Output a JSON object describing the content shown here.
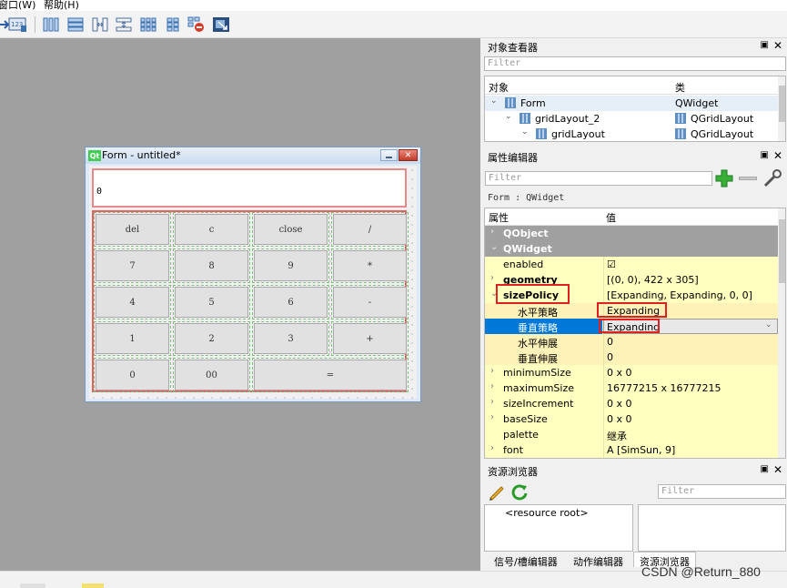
{
  "menubar": {
    "window_menu": "窗口(W)",
    "help_menu": "帮助(H)"
  },
  "toolbar": {
    "icons": [
      "tab-order-icon",
      "layout-horizontal-icon",
      "layout-vertical-icon",
      "splitter-horizontal-icon",
      "splitter-vertical-icon",
      "layout-form-icon",
      "layout-grid-icon",
      "break-layout-icon",
      "adjust-size-icon"
    ]
  },
  "form": {
    "window_title": "Form - untitled*",
    "logo_text": "Qt",
    "display_value": "0",
    "buttons": [
      {
        "label": "del"
      },
      {
        "label": "c"
      },
      {
        "label": "close"
      },
      {
        "label": "/"
      },
      {
        "label": "7"
      },
      {
        "label": "8"
      },
      {
        "label": "9"
      },
      {
        "label": "*"
      },
      {
        "label": "4"
      },
      {
        "label": "5"
      },
      {
        "label": "6"
      },
      {
        "label": "-"
      },
      {
        "label": "1"
      },
      {
        "label": "2"
      },
      {
        "label": "3"
      },
      {
        "label": "+"
      },
      {
        "label": "0"
      },
      {
        "label": "00"
      },
      {
        "label": "="
      }
    ]
  },
  "object_inspector": {
    "title": "对象查看器",
    "filter_placeholder": "Filter",
    "col_object": "对象",
    "col_class": "类",
    "rows": [
      {
        "name": "Form",
        "class": "QWidget"
      },
      {
        "name": "gridLayout_2",
        "class": "QGridLayout"
      },
      {
        "name": "gridLayout",
        "class": "QGridLayout"
      }
    ]
  },
  "property_editor": {
    "title": "属性编辑器",
    "filter_placeholder": "Filter",
    "context": "Form : QWidget",
    "col_property": "属性",
    "col_value": "值",
    "rows": [
      {
        "name": "QObject",
        "value": "",
        "kind": "category"
      },
      {
        "name": "QWidget",
        "value": "",
        "kind": "category"
      },
      {
        "name": "enabled",
        "value": "☑",
        "kind": "prop"
      },
      {
        "name": "geometry",
        "value": "[(0, 0), 422 x 305]",
        "kind": "prop"
      },
      {
        "name": "sizePolicy",
        "value": "[Expanding, Expanding, 0, 0]",
        "kind": "prop"
      },
      {
        "name": "水平策略",
        "value": "Expanding",
        "kind": "sub"
      },
      {
        "name": "垂直策略",
        "value": "Expanding",
        "kind": "sub"
      },
      {
        "name": "水平伸展",
        "value": "0",
        "kind": "sub"
      },
      {
        "name": "垂直伸展",
        "value": "0",
        "kind": "sub"
      },
      {
        "name": "minimumSize",
        "value": "0 x 0",
        "kind": "prop"
      },
      {
        "name": "maximumSize",
        "value": "16777215 x 16777215",
        "kind": "prop"
      },
      {
        "name": "sizeIncrement",
        "value": "0 x 0",
        "kind": "prop"
      },
      {
        "name": "baseSize",
        "value": "0 x 0",
        "kind": "prop"
      },
      {
        "name": "palette",
        "value": "继承",
        "kind": "prop"
      },
      {
        "name": "font",
        "value": "A  [SimSun, 9]",
        "kind": "prop"
      }
    ]
  },
  "resource_browser": {
    "title": "资源浏览器",
    "filter_placeholder": "Filter",
    "root_label": "<resource root>"
  },
  "bottom_tabs": [
    "信号/槽编辑器",
    "动作编辑器",
    "资源浏览器"
  ],
  "watermark": "CSDN @Return_880",
  "colors": {
    "highlight": "#e02020",
    "selection": "#0078d7",
    "property_yellow": "#ffffc0",
    "category_grey": "#a0a0a0"
  }
}
